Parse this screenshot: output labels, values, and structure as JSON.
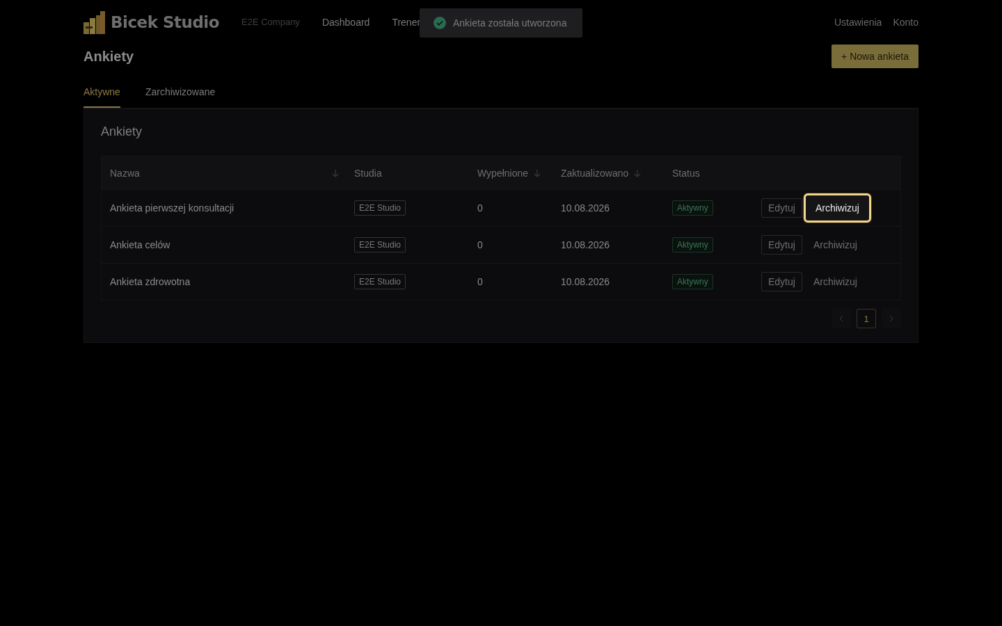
{
  "brand": {
    "name": "Bicek Studio"
  },
  "nav": [
    {
      "label": "E2E Company",
      "kind": "company"
    },
    {
      "label": "Dashboard",
      "kind": "link"
    },
    {
      "label": "Trener",
      "kind": "link"
    }
  ],
  "nav_right": [
    "Ustawienia",
    "Konto"
  ],
  "toast": {
    "text": "Ankieta została utworzona"
  },
  "page": {
    "title": "Ankiety",
    "new_button": "+ Nowa ankieta"
  },
  "tabs": [
    {
      "label": "Aktywne",
      "selected": true
    },
    {
      "label": "Zarchiwizowane",
      "selected": false
    }
  ],
  "card": {
    "title": "Ankiety"
  },
  "table": {
    "columns": [
      {
        "label": "Nazwa",
        "sortable": true
      },
      {
        "label": "Studia",
        "sortable": false
      },
      {
        "label": "Wypełnione",
        "sortable": true
      },
      {
        "label": "Zaktualizowano",
        "sortable": true
      },
      {
        "label": "Status",
        "sortable": false
      }
    ],
    "rows": [
      {
        "name": "Ankieta pierwszej konsultacji",
        "studio": "E2E Studio",
        "filled": "0",
        "updated": "10.08.2026",
        "status": "Aktywny",
        "edit": "Edytuj",
        "archive": "Archiwizuj",
        "archive_highlighted": true
      },
      {
        "name": "Ankieta celów",
        "studio": "E2E Studio",
        "filled": "0",
        "updated": "10.08.2026",
        "status": "Aktywny",
        "edit": "Edytuj",
        "archive": "Archiwizuj",
        "archive_highlighted": false
      },
      {
        "name": "Ankieta zdrowotna",
        "studio": "E2E Studio",
        "filled": "0",
        "updated": "10.08.2026",
        "status": "Aktywny",
        "edit": "Edytuj",
        "archive": "Archiwizuj",
        "archive_highlighted": false
      }
    ]
  },
  "pagination": {
    "pages": [
      {
        "label": "1",
        "selected": true
      }
    ]
  }
}
